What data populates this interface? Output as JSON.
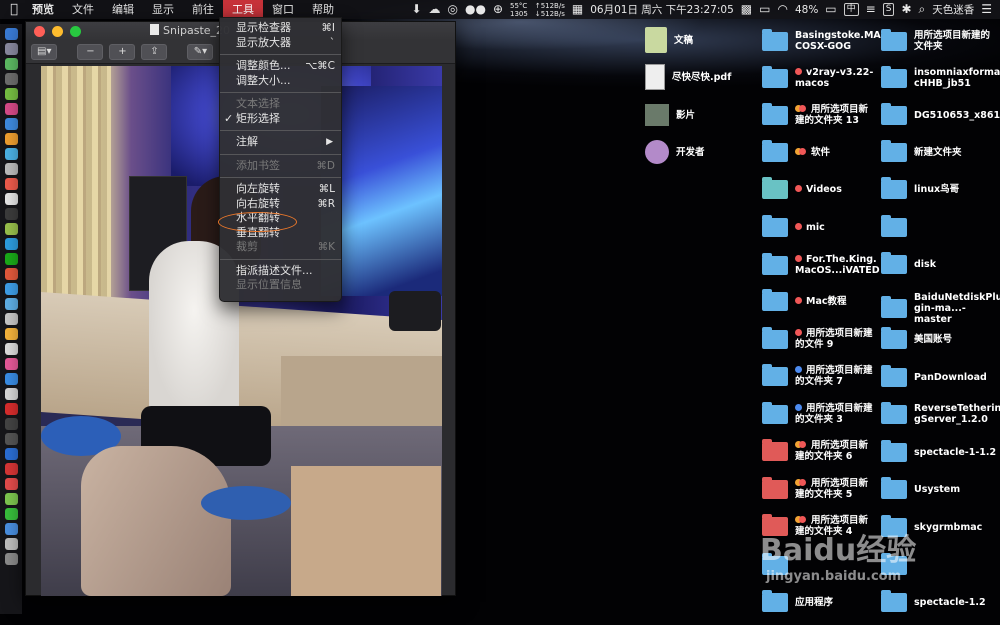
{
  "menubar": {
    "apple_icon": "apple-logo",
    "items": [
      "预览",
      "文件",
      "编辑",
      "显示",
      "前往",
      "工具",
      "窗口",
      "帮助"
    ],
    "active_index": 5,
    "status": {
      "cpu_temp": "55°C",
      "fan": "1305",
      "net_up": "↑512B/s",
      "net_down": "↓512B/s",
      "datetime": "06月01日 周六 下午23:27:05",
      "battery": "48%",
      "input_method": "中",
      "user": "天色迷香"
    }
  },
  "window": {
    "title": "Snipaste_20",
    "accent_close": "#ff5f57",
    "accent_min": "#febc2e",
    "accent_max": "#28c840"
  },
  "tools_menu": {
    "items": [
      {
        "label": "显示检查器",
        "shortcut": "⌘I",
        "enabled": true
      },
      {
        "label": "显示放大器",
        "shortcut": "`",
        "enabled": true
      },
      {
        "label": "调整颜色...",
        "shortcut": "⌥⌘C",
        "enabled": true
      },
      {
        "label": "调整大小...",
        "shortcut": "",
        "enabled": true
      },
      {
        "label": "文本选择",
        "shortcut": "",
        "enabled": false
      },
      {
        "label": "矩形选择",
        "shortcut": "",
        "enabled": true,
        "checked": true
      },
      {
        "label": "注解",
        "shortcut": "",
        "enabled": true,
        "submenu": true
      },
      {
        "label": "添加书签",
        "shortcut": "⌘D",
        "enabled": false
      },
      {
        "label": "向左旋转",
        "shortcut": "⌘L",
        "enabled": true
      },
      {
        "label": "向右旋转",
        "shortcut": "⌘R",
        "enabled": true
      },
      {
        "label": "水平翻转",
        "shortcut": "",
        "enabled": true,
        "highlighted_by_annotation": true
      },
      {
        "label": "垂直翻转",
        "shortcut": "",
        "enabled": true
      },
      {
        "label": "裁剪",
        "shortcut": "⌘K",
        "enabled": false
      },
      {
        "label": "指派描述文件...",
        "shortcut": "",
        "enabled": true
      },
      {
        "label": "显示位置信息",
        "shortcut": "",
        "enabled": false
      }
    ],
    "check_mark": "✓",
    "submenu_arrow": "▶",
    "annotation_color": "#e9772b"
  },
  "desktop": {
    "col1": [
      {
        "label": "文稿",
        "icon": "document-file-icon"
      },
      {
        "label": "尽快尽快.pdf",
        "icon": "pdf-file-icon"
      },
      {
        "label": "影片",
        "icon": "movie-file-icon"
      },
      {
        "label": "开发者",
        "icon": "developer-file-icon"
      }
    ],
    "col2": [
      {
        "line1": "Basingstoke.MA",
        "line2": "COSX-GOG",
        "tag": "",
        "folder": "blue"
      },
      {
        "line1": "v2ray-v3.22-",
        "line2": "macos",
        "tag": "red",
        "folder": "blue"
      },
      {
        "line1": "用所选项目新",
        "line2": "建的文件夹 13",
        "tag": "pair",
        "folder": "blue"
      },
      {
        "line1": "软件",
        "line2": "",
        "tag": "pair",
        "folder": "blue"
      },
      {
        "line1": "Videos",
        "line2": "",
        "tag": "red",
        "folder": "teal"
      },
      {
        "line1": "mic",
        "line2": "",
        "tag": "red",
        "folder": "blue"
      },
      {
        "line1": "For.The.King.",
        "line2": "MacOS...iVATED",
        "tag": "red",
        "folder": "blue"
      },
      {
        "line1": "Mac教程",
        "line2": "",
        "tag": "red",
        "folder": "blue"
      },
      {
        "line1": "用所选项目新建",
        "line2": "的文件 9",
        "tag": "red",
        "folder": "blue"
      },
      {
        "line1": "用所选项目新建",
        "line2": "的文件夹 7",
        "tag": "blue",
        "folder": "blue"
      },
      {
        "line1": "用所选项目新建",
        "line2": "的文件夹 3",
        "tag": "blue",
        "folder": "blue"
      },
      {
        "line1": "用所选项目新",
        "line2": "建的文件夹 6",
        "tag": "pair",
        "folder": "red"
      },
      {
        "line1": "用所选项目新",
        "line2": "建的文件夹 5",
        "tag": "pair",
        "folder": "red"
      },
      {
        "line1": "用所选项目新",
        "line2": "建的文件夹 4",
        "tag": "pair",
        "folder": "red"
      },
      {
        "line1": "",
        "line2": "",
        "tag": "",
        "folder": "blue"
      },
      {
        "line1": "应用程序",
        "line2": "",
        "tag": "",
        "folder": "app"
      }
    ],
    "col3": [
      {
        "line1": "用所选项目新建的",
        "line2": "文件夹"
      },
      {
        "line1": "insomniaxforma",
        "line2": "cHHB_jb51"
      },
      {
        "line1": "DG510653_x861",
        "line2": ""
      },
      {
        "line1": "新建文件夹",
        "line2": ""
      },
      {
        "line1": "linux鸟哥",
        "line2": ""
      },
      {
        "line1": "",
        "line2": ""
      },
      {
        "line1": "disk",
        "line2": ""
      },
      {
        "line1": "BaiduNetdiskPlu",
        "line2": "gin-ma...-master"
      },
      {
        "line1": "美国账号",
        "line2": ""
      },
      {
        "line1": "PanDownload",
        "line2": ""
      },
      {
        "line1": "ReverseTetherin",
        "line2": "gServer_1.2.0"
      },
      {
        "line1": "spectacle-1-1.2",
        "line2": ""
      },
      {
        "line1": "Usystem",
        "line2": ""
      },
      {
        "line1": "skygrmbmac",
        "line2": ""
      },
      {
        "line1": "",
        "line2": ""
      },
      {
        "line1": "spectacle-1.2",
        "line2": ""
      }
    ]
  },
  "watermark": {
    "logo": "Baidu经验",
    "url": "jingyan.baidu.com"
  }
}
